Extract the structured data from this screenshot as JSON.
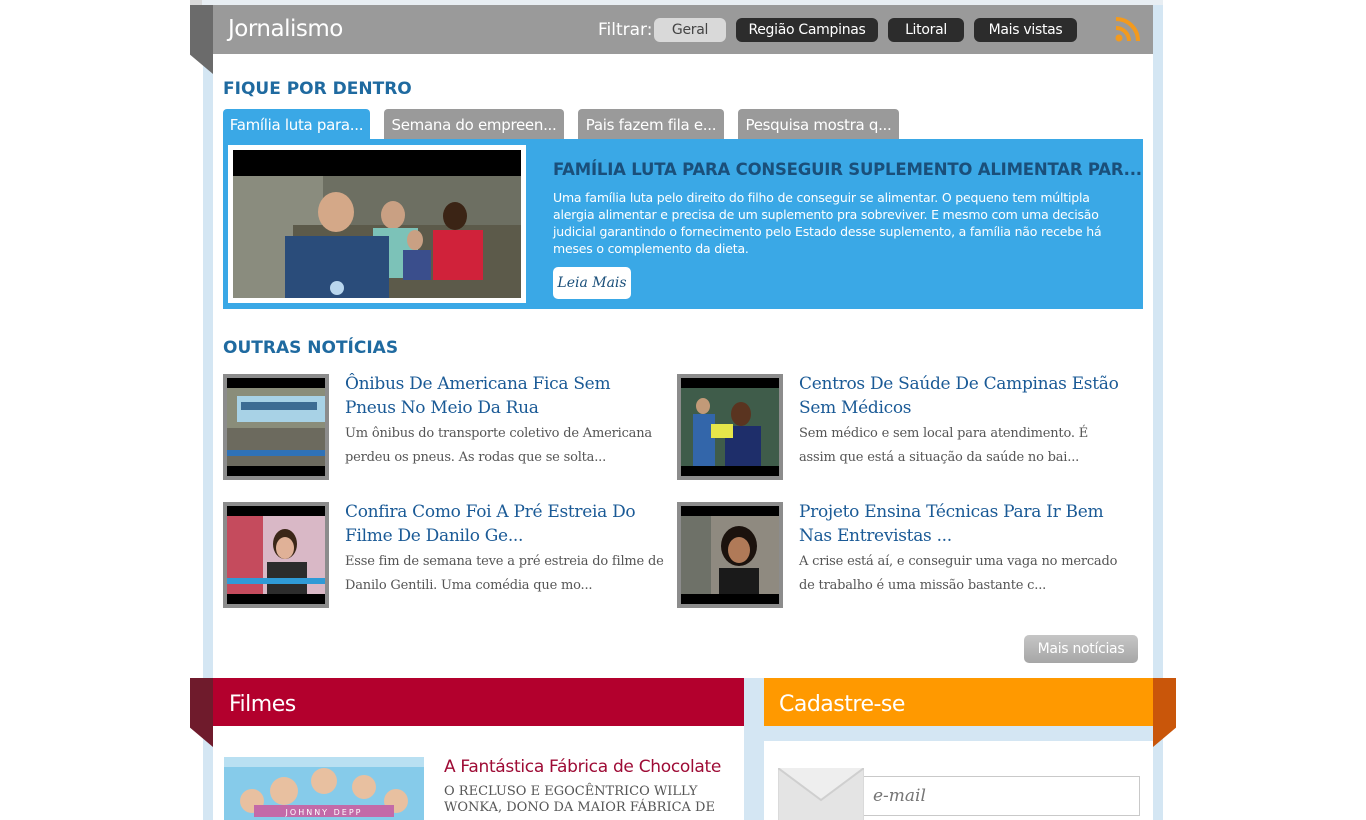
{
  "header": {
    "title": "Jornalismo",
    "filter_label": "Filtrar:",
    "filters": [
      {
        "label": "Geral",
        "active": true
      },
      {
        "label": "Região Campinas",
        "active": false
      },
      {
        "label": "Litoral",
        "active": false
      },
      {
        "label": "Mais vistas",
        "active": false
      }
    ],
    "rss_icon": "rss-icon"
  },
  "fique": {
    "title": "FIQUE POR DENTRO",
    "tabs": [
      {
        "label": "Família luta para...",
        "active": true
      },
      {
        "label": "Semana do empreen...",
        "active": false
      },
      {
        "label": "Pais fazem fila e...",
        "active": false
      },
      {
        "label": "Pesquisa mostra q...",
        "active": false
      }
    ],
    "feature": {
      "title": "FAMÍLIA LUTA PARA CONSEGUIR SUPLEMENTO ALIMENTAR PAR...",
      "description": "Uma família luta pelo direito do filho de conseguir se alimentar. O pequeno tem múltipla alergia alimentar e precisa de um suplemento pra sobreviver. E mesmo com uma decisão judicial garantindo o fornecimento pelo Estado desse suplemento, a família não recebe há meses o complemento da dieta.",
      "button": "Leia Mais"
    }
  },
  "outras": {
    "title": "OUTRAS NOTÍCIAS",
    "items": [
      {
        "title": "Ônibus De Americana Fica Sem Pneus No Meio Da Rua",
        "desc": "Um ônibus do transporte coletivo de Americana perdeu os pneus. As rodas que se solta..."
      },
      {
        "title": "Centros De Saúde De Campinas Estão Sem Médicos",
        "desc": "Sem médico e sem local para atendimento. É assim que está a situação da saúde no bai..."
      },
      {
        "title": "Confira Como Foi A Pré Estreia Do Filme De Danilo Ge...",
        "desc": "Esse fim de semana teve a pré estreia do filme de Danilo Gentili. Uma comédia que mo..."
      },
      {
        "title": "Projeto Ensina Técnicas Para Ir Bem Nas Entrevistas ...",
        "desc": "A crise está aí, e conseguir uma vaga no mercado de trabalho é uma missão bastante c..."
      }
    ],
    "more_button": "Mais notícias"
  },
  "filmes": {
    "title": "Filmes",
    "movie": {
      "title": "A Fantástica Fábrica de Chocolate",
      "desc": "O recluso e egocêntrico Willy Wonka, dono da maior fábrica de",
      "poster_text": "JOHNNY DEPP"
    }
  },
  "cadastro": {
    "title": "Cadastre-se",
    "email_placeholder": "e-mail"
  }
}
